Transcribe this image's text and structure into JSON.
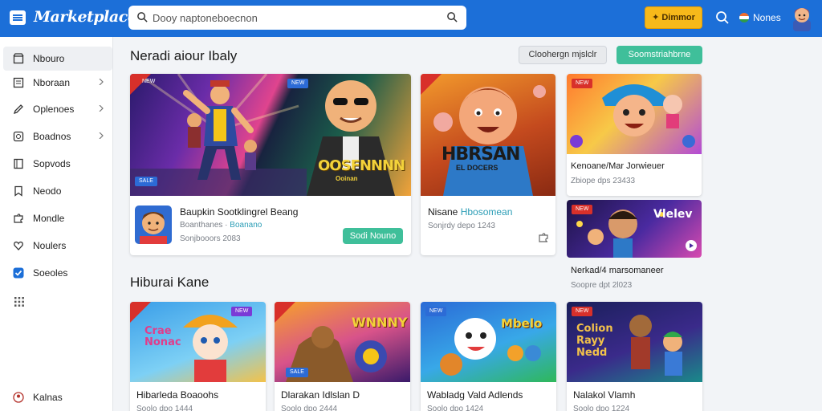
{
  "app": {
    "logo": "Marketplace",
    "search_value": "Dooy naptoneboecnon",
    "promo_label": "Dimmor",
    "lang_label": "Nones"
  },
  "sidebar": {
    "items": [
      {
        "label": "Nbouro",
        "icon": "store-icon",
        "active": true,
        "chevron": false
      },
      {
        "label": "Nboraan",
        "icon": "grid-icon",
        "active": false,
        "chevron": true
      },
      {
        "label": "Oplenoes",
        "icon": "pencil-icon",
        "active": false,
        "chevron": true
      },
      {
        "label": "Boadnos",
        "icon": "box-icon",
        "active": false,
        "chevron": true
      },
      {
        "label": "Sopvods",
        "icon": "book-icon",
        "active": false,
        "chevron": false
      },
      {
        "label": "Neodo",
        "icon": "bookmark-icon",
        "active": false,
        "chevron": false
      },
      {
        "label": "Mondle",
        "icon": "puzzle-icon",
        "active": false,
        "chevron": false
      },
      {
        "label": "Noulers",
        "icon": "heart-icon",
        "active": false,
        "chevron": false
      },
      {
        "label": "Soeoles",
        "icon": "check-icon",
        "active": false,
        "chevron": false
      }
    ],
    "footer_label": "Kalnas"
  },
  "featured": {
    "title": "Neradi aiour Ibaly",
    "btn_secondary": "Cloohergn mjslclr",
    "btn_primary": "Soomstriahbrne"
  },
  "cards": {
    "hero": {
      "badge_top": "NEW",
      "badge_top_right": "NEW",
      "badge_bottom": "SALE",
      "art_text": "OOSFNNNN",
      "art_subtext": "Ooinan",
      "title": "Baupkin Sootklingrel Beang",
      "sub1_prefix": "Boanthanes ·",
      "sub1_teal": "Boanano",
      "sub2": "Sonjbooors 2083",
      "button": "Sodi Nouno"
    },
    "mid": {
      "art_text": "HBRSAN",
      "art_subtext": "EL DOCERS",
      "title_prefix": "Nisane",
      "title_teal": "Hbosomean",
      "sub": "Sonjrdy depo 1243"
    },
    "right_top": {
      "title": "Kenoane/Mar Jorwieuer",
      "sub": "Zbiope dps 23433"
    },
    "right_bottom": {
      "art_text": "Vlelev",
      "title": "Nerkad/4 marsomaneer",
      "sub": "Soopre dpt 2l023"
    }
  },
  "section2": {
    "title": "Hiburai Kane",
    "cards": [
      {
        "art_text": "Crae Nonac",
        "title": "Hibarleda Boaoohs",
        "sub": "Soolo dpo 1444"
      },
      {
        "art_text": "WNNNY",
        "title": "Dlarakan Idlslan D",
        "sub": "Soolo dpo 2444"
      },
      {
        "art_text": "Mbelo",
        "title": "Wabladg Vald Adlends",
        "sub": "Soolo dpo 1424"
      },
      {
        "art_text": "Colion Rayy Nedd",
        "title": "Nalakol Vlamh",
        "sub": "Soolo dpo 1224"
      }
    ]
  },
  "colors": {
    "topbar": "#1c6fd8",
    "accent_green": "#3fbf9a",
    "promo_yellow": "#f7b91a",
    "teal_text": "#2b9db6"
  }
}
